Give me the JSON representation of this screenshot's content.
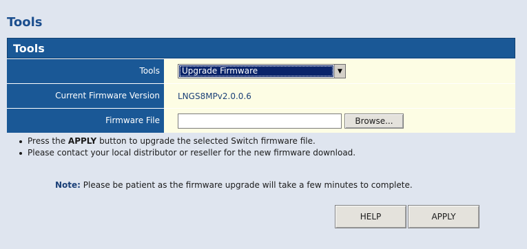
{
  "page": {
    "title": "Tools"
  },
  "panel": {
    "header": "Tools",
    "rows": [
      {
        "label": "Tools",
        "select_value": "Upgrade Firmware"
      },
      {
        "label": "Current Firmware Version",
        "value": "LNGS8MPv2.0.0.6"
      },
      {
        "label": "Firmware File",
        "file_value": "",
        "browse_label": "Browse..."
      }
    ]
  },
  "notes": {
    "item1": {
      "prefix": "Press the ",
      "bold": "APPLY",
      "suffix": " button to upgrade the selected Switch firmware file."
    },
    "item2": "Please contact your local distributor or reseller for the new firmware download.",
    "note_label": "Note:",
    "note_text": " Please be patient as the firmware upgrade will take a few minutes to complete."
  },
  "buttons": {
    "help": "HELP",
    "apply": "APPLY"
  }
}
